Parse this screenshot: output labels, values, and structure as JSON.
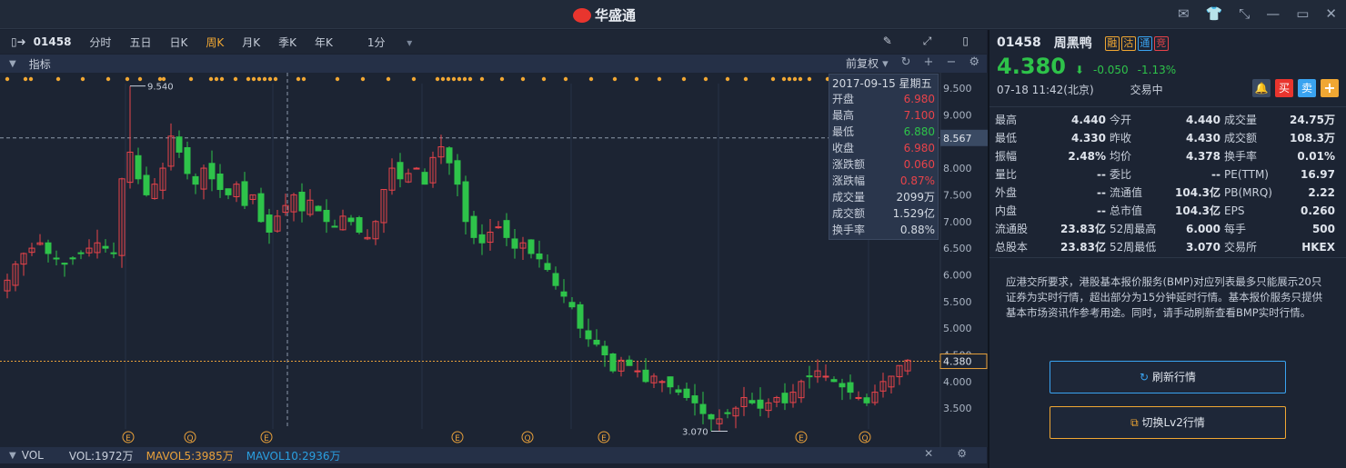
{
  "app": {
    "title": "华盛通"
  },
  "toolbar": {
    "code": "01458",
    "periods": [
      "分时",
      "五日",
      "日K",
      "周K",
      "月K",
      "季K",
      "年K"
    ],
    "active": "周K",
    "minute": "1分"
  },
  "indicator": {
    "label": "指标",
    "adjust": "前复权"
  },
  "tooltip": {
    "date": "2017-09-15 星期五",
    "rows": [
      {
        "k": "开盘",
        "v": "6.980",
        "c": "r"
      },
      {
        "k": "最高",
        "v": "7.100",
        "c": "r"
      },
      {
        "k": "最低",
        "v": "6.880",
        "c": "g"
      },
      {
        "k": "收盘",
        "v": "6.980",
        "c": "r"
      },
      {
        "k": "涨跌额",
        "v": "0.060",
        "c": "r"
      },
      {
        "k": "涨跌幅",
        "v": "0.87%",
        "c": "r"
      },
      {
        "k": "成交量",
        "v": "2099万",
        "c": "w"
      },
      {
        "k": "成交额",
        "v": "1.529亿",
        "c": "w"
      },
      {
        "k": "换手率",
        "v": "0.88%",
        "c": "w"
      }
    ]
  },
  "chart_data": {
    "type": "candlestick",
    "period": "weekly",
    "ylim": [
      3.2,
      9.7
    ],
    "yticks": [
      "9.500",
      "9.000",
      "8.000",
      "7.500",
      "7.000",
      "6.500",
      "6.000",
      "5.500",
      "5.000",
      "4.500",
      "4.000",
      "3.500"
    ],
    "crosshair_price": "8.567",
    "last_price": "4.380",
    "max_label": "9.540",
    "min_label": "3.070",
    "closes": [
      5.9,
      6.2,
      6.4,
      6.5,
      6.6,
      6.4,
      6.3,
      6.2,
      6.3,
      6.4,
      6.5,
      6.6,
      6.5,
      6.4,
      7.8,
      8.3,
      7.8,
      7.5,
      7.7,
      8.0,
      8.6,
      8.3,
      7.9,
      7.7,
      8.0,
      7.8,
      7.6,
      7.5,
      7.7,
      7.3,
      7.5,
      7.0,
      6.8,
      7.1,
      7.3,
      7.5,
      7.2,
      7.4,
      7.2,
      7.0,
      6.9,
      7.1,
      7.0,
      6.8,
      6.7,
      7.0,
      7.6,
      8.0,
      7.8,
      7.9,
      8.0,
      7.7,
      8.2,
      8.4,
      8.1,
      7.7,
      7.0,
      6.7,
      6.6,
      6.8,
      6.9,
      6.7,
      6.5,
      6.6,
      6.4,
      6.3,
      6.1,
      5.8,
      5.6,
      5.4,
      5.0,
      4.8,
      4.7,
      4.5,
      4.2,
      4.4,
      4.3,
      4.2,
      4.0,
      4.1,
      4.0,
      3.9,
      3.8,
      3.7,
      3.6,
      3.4,
      3.3,
      3.3,
      3.4,
      3.5,
      3.7,
      3.6,
      3.5,
      3.6,
      3.7,
      3.6,
      3.8,
      4.0,
      4.1,
      4.2,
      4.1,
      4.0,
      3.9,
      3.8,
      3.7,
      3.6,
      3.8,
      4.0,
      4.1,
      4.3,
      4.4
    ],
    "events": [
      "E",
      "Q",
      "E",
      "E",
      "Q",
      "E",
      "E",
      "Q"
    ]
  },
  "vol": {
    "label": "VOL",
    "vol": "VOL:1972万",
    "mavol5": "MAVOL5:3985万",
    "mavol10": "MAVOL10:2936万"
  },
  "side": {
    "code": "01458",
    "name": "周黑鸭",
    "tags": [
      "融",
      "沽",
      "通",
      "竞"
    ],
    "price": "4.380",
    "change": "-0.050",
    "pct": "-1.13%",
    "time": "07-18  11:42(北京)",
    "state": "交易中",
    "buy": "买",
    "sell": "卖",
    "add": "+",
    "stats": [
      {
        "k": "最高",
        "v": "4.440",
        "c": "r"
      },
      {
        "k": "今开",
        "v": "4.440",
        "c": "r"
      },
      {
        "k": "成交量",
        "v": "24.75万",
        "c": ""
      },
      {
        "k": "最低",
        "v": "4.330",
        "c": "g"
      },
      {
        "k": "昨收",
        "v": "4.430",
        "c": ""
      },
      {
        "k": "成交额",
        "v": "108.3万",
        "c": ""
      },
      {
        "k": "振幅",
        "v": "2.48%",
        "c": ""
      },
      {
        "k": "均价",
        "v": "4.378",
        "c": ""
      },
      {
        "k": "换手率",
        "v": "0.01%",
        "c": ""
      },
      {
        "k": "量比",
        "v": "--",
        "c": ""
      },
      {
        "k": "委比",
        "v": "--",
        "c": ""
      },
      {
        "k": "PE(TTM)",
        "v": "16.97",
        "c": ""
      },
      {
        "k": "外盘",
        "v": "--",
        "c": ""
      },
      {
        "k": "流通值",
        "v": "104.3亿",
        "c": ""
      },
      {
        "k": "PB(MRQ)",
        "v": "2.22",
        "c": ""
      },
      {
        "k": "内盘",
        "v": "--",
        "c": ""
      },
      {
        "k": "总市值",
        "v": "104.3亿",
        "c": ""
      },
      {
        "k": "EPS",
        "v": "0.260",
        "c": ""
      },
      {
        "k": "流通股",
        "v": "23.83亿",
        "c": ""
      },
      {
        "k": "52周最高",
        "v": "6.000",
        "c": "r"
      },
      {
        "k": "每手",
        "v": "500",
        "c": ""
      },
      {
        "k": "总股本",
        "v": "23.83亿",
        "c": ""
      },
      {
        "k": "52周最低",
        "v": "3.070",
        "c": "g"
      },
      {
        "k": "交易所",
        "v": "HKEX",
        "c": ""
      }
    ],
    "notice": "应港交所要求，港股基本报价服务(BMP)对应列表最多只能展示20只证券为实时行情，超出部分为15分钟延时行情。基本报价服务只提供基本市场资讯作参考用途。同时，请手动刷新查看BMP实时行情。",
    "refresh": "刷新行情",
    "switch": "切换Lv2行情"
  },
  "colors": {
    "up": "#e8434a",
    "down": "#2ec34a",
    "accent": "#f0a733"
  }
}
